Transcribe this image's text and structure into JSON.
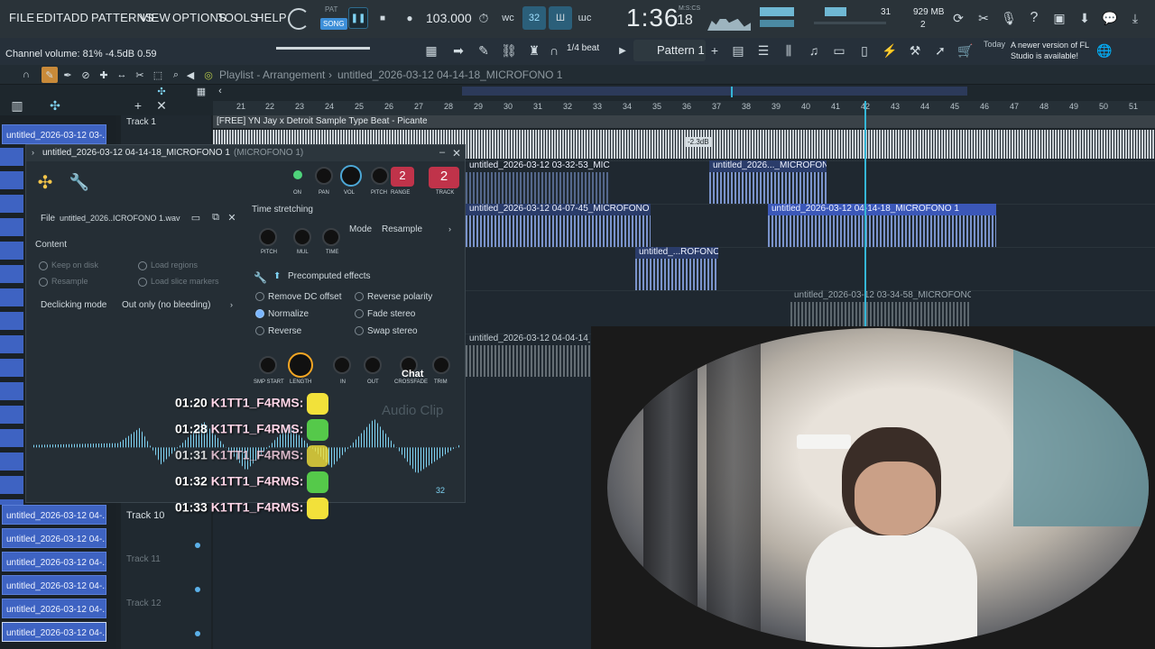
{
  "menubar": {
    "items": [
      "FILE",
      "EDIT",
      "ADD",
      "PATTERNS",
      "VIEW",
      "OPTIONS",
      "TOOLS",
      "HELP"
    ],
    "pat_label": "PAT",
    "song_label": "SONG",
    "tempo": "103.000",
    "time": "1:36",
    "time_frac": "18",
    "time_unit": "M:S:CS",
    "cpu_value": "31",
    "mem": "929 MB",
    "mem_sub": "2"
  },
  "hint": {
    "channel_volume": "Channel volume: 81%  -4.5dB  0.59",
    "snap": "1/4 beat",
    "pattern": "Pattern 1",
    "news_date": "Today",
    "news": "A newer version of FL Studio is available!"
  },
  "playlist": {
    "title": "Playlist - Arrangement",
    "sep": "›",
    "file": "untitled_2026-03-12 04-14-18_MICROFONO 1",
    "ruler": [
      "21",
      "22",
      "23",
      "24",
      "25",
      "26",
      "27",
      "28",
      "29",
      "30",
      "31",
      "32",
      "33",
      "34",
      "35",
      "36",
      "37",
      "38",
      "39",
      "40",
      "41",
      "42",
      "43",
      "44",
      "45",
      "46",
      "47",
      "48",
      "49",
      "50",
      "51"
    ],
    "track1": "Track 1",
    "track10": "Track 10",
    "track11": "Track 11",
    "track12": "Track 12",
    "top_clip": "[FREE] YN Jay x Detroit Sample Type Beat - Picante",
    "top_db": "-2.3dB"
  },
  "channels": [
    "untitled_2026-03-12 03-...",
    "untitled_2026-03-12 04-...",
    "untitled_2026-03-12 04-...",
    "untitled_2026-03-12 04-...",
    "untitled_2026-03-12 04-...",
    "untitled_2026-03-12 04-...",
    "untitled_2026-03-12 04-...",
    "untitled_2026-03-12 04-..."
  ],
  "clips": {
    "c1": "untitled_2026-03-12 03-32-53_MICROFONO 1",
    "c2": "untitled_2026..._MICROFONO 1",
    "c3": "untitled_2026-03-12 04-07-45_MICROFONO 1",
    "c4": "untitled_2026-03-12 04-14-18_MICROFONO 1",
    "c5": "untitled_...ROFONO 1",
    "c6": "untitled_2026-03-12 03-34-58_MICROFONO 1",
    "c7": "untitled_2026-03-12 04-04-14_MICRO"
  },
  "sampler": {
    "title": "untitled_2026-03-12 04-14-18_MICROFONO 1",
    "title_sub": "(MICROFONO 1)",
    "file_label": "File",
    "file_name": "untitled_2026..ICROFONO 1.wav",
    "knob_labels": [
      "ON",
      "PAN",
      "VOL",
      "PITCH",
      "RANGE",
      "TRACK"
    ],
    "range_val": "2",
    "track_val": "2",
    "content": "Content",
    "keep_on_disk": "Keep on disk",
    "resample": "Resample",
    "load_regions": "Load regions",
    "load_slice": "Load slice markers",
    "declick_label": "Declicking mode",
    "declick_value": "Out only (no bleeding)",
    "time_stretching": "Time stretching",
    "ts_knobs": [
      "PITCH",
      "MUL",
      "TIME"
    ],
    "mode_label": "Mode",
    "mode_value": "Resample",
    "precomputed": "Precomputed effects",
    "fx": [
      "Remove DC offset",
      "Reverse polarity",
      "Normalize",
      "Fade stereo",
      "Reverse",
      "Swap stereo"
    ],
    "bottom_knobs": [
      "SMP START",
      "LENGTH",
      "IN",
      "OUT",
      "CROSSFADE",
      "TRIM"
    ],
    "chat_label": "Chat",
    "watermark": "Audio Clip",
    "zoom": "32"
  },
  "chat": [
    {
      "time": "01:20",
      "name": "K1TT1_F4RMS:",
      "color": "#f2e13a"
    },
    {
      "time": "01:28",
      "name": "K1TT1_F4RMS:",
      "color": "#55c94a"
    },
    {
      "time": "01:31",
      "name": "K1TT1_F4RMS:",
      "color": "#f2e13a"
    },
    {
      "time": "01:32",
      "name": "K1TT1_F4RMS:",
      "color": "#55c94a"
    },
    {
      "time": "01:33",
      "name": "K1TT1_F4RMS:",
      "color": "#f2e13a"
    }
  ],
  "colors": {
    "accent": "#35b6d6",
    "clip": "#3e63c2",
    "knob_orange": "#f5a623",
    "red_badge": "#c0334a"
  }
}
